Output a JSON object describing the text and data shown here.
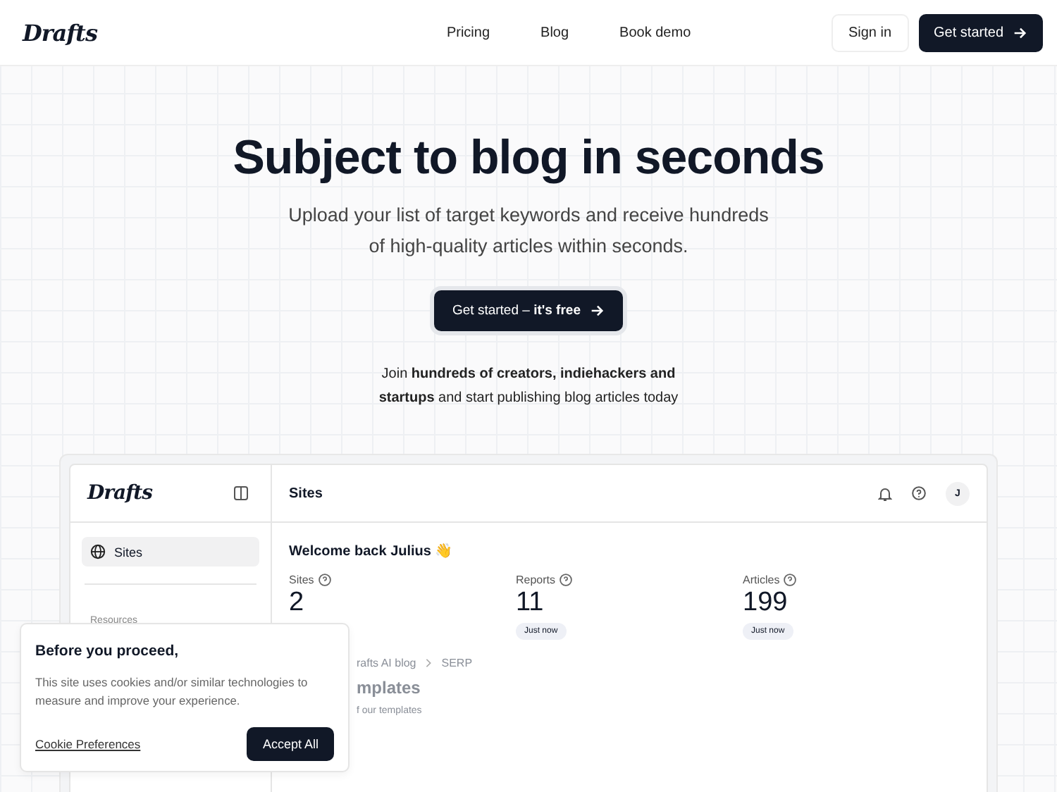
{
  "nav": {
    "logo": "Drafts",
    "links": [
      "Pricing",
      "Blog",
      "Book demo"
    ],
    "sign_in": "Sign in",
    "get_started": "Get started"
  },
  "hero": {
    "title": "Subject to blog in seconds",
    "subtitle": "Upload your list of target keywords and receive hundreds of high-quality articles within seconds.",
    "cta": "Get started – **it's free**",
    "social_proof": "Join **hundreds of creators, indiehackers and startups** and start publishing blog articles today"
  },
  "app": {
    "logo": "Drafts",
    "sidebar": {
      "items": [
        {
          "label": "Sites",
          "selected": true
        }
      ],
      "section": "Resources"
    },
    "header": {
      "title": "Sites",
      "avatar": "J"
    },
    "welcome": "Welcome back Julius 👋",
    "stats": [
      {
        "label": "Sites",
        "value": "2"
      },
      {
        "label": "Reports",
        "value": "11",
        "badge": "Just now"
      },
      {
        "label": "Articles",
        "value": "199",
        "badge": "Just now"
      }
    ],
    "breadcrumb": [
      "rafts AI blog",
      "SERP"
    ],
    "section_title": "mplates",
    "section_subtitle": "f our templates"
  },
  "cookie": {
    "title": "Before you proceed,",
    "text": "This site uses cookies and/or similar technologies to measure and improve your experience.",
    "link": "Cookie Preferences",
    "accept": "Accept All"
  }
}
